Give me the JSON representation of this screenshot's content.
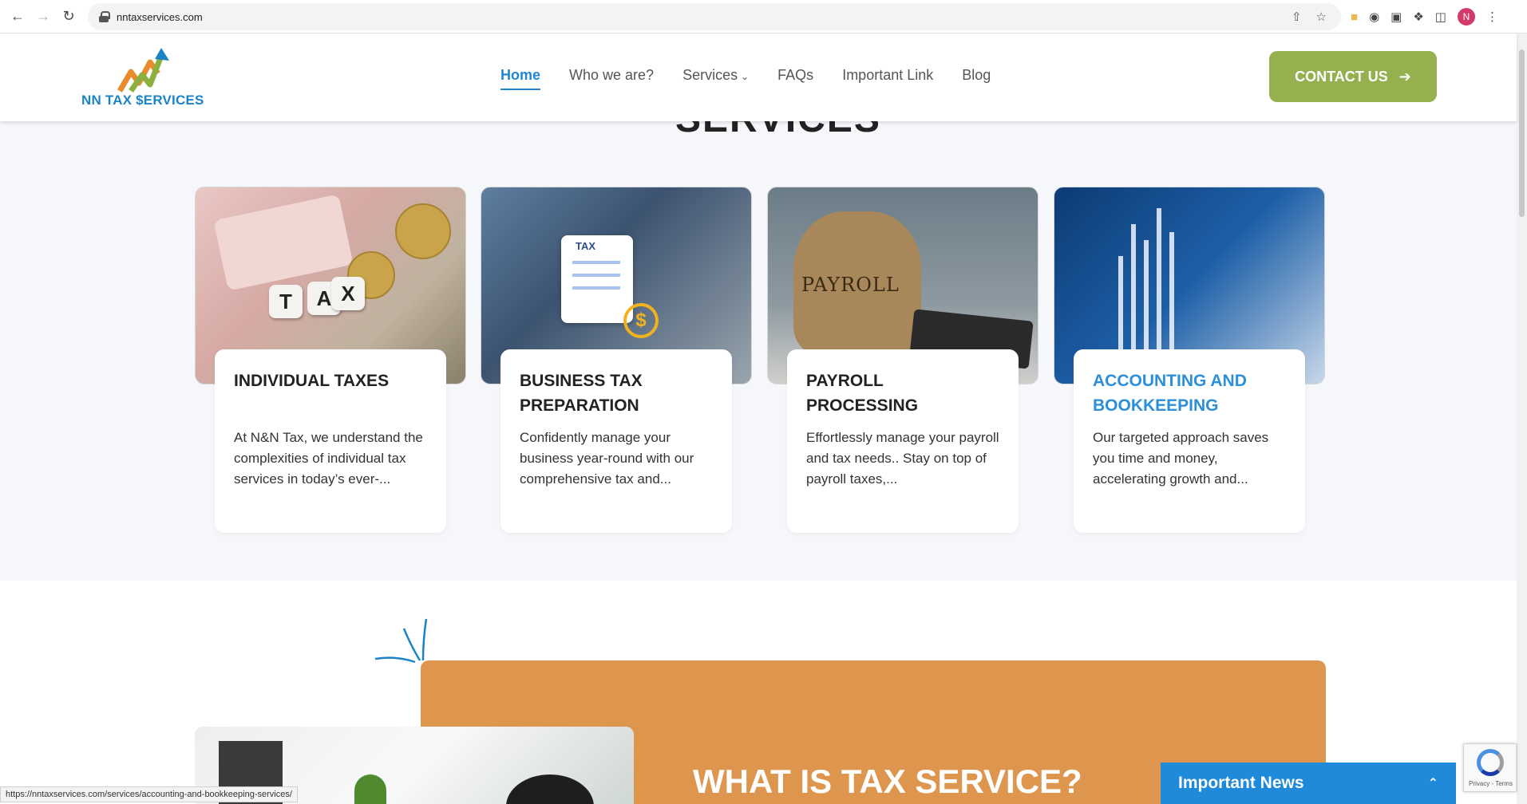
{
  "browser": {
    "url": "nntaxservices.com",
    "status_url": "https://nntaxservices.com/services/accounting-and-bookkeeping-services/",
    "avatar_letter": "N"
  },
  "header": {
    "logo_text": "NN TAX $ERVICES",
    "nav": [
      {
        "label": "Home",
        "active": true
      },
      {
        "label": "Who we are?"
      },
      {
        "label": "Services"
      },
      {
        "label": "FAQs"
      },
      {
        "label": "Important Link"
      },
      {
        "label": "Blog"
      }
    ],
    "contact_label": "CONTACT US"
  },
  "services": {
    "section_title_partial": "SERVICES",
    "cards": [
      {
        "title": "INDIVIDUAL TAXES",
        "description": "At N&N Tax, we understand the complexities of individual tax services in today’s ever-..."
      },
      {
        "title": "BUSINESS TAX PREPARATION",
        "description": "Confidently manage your business year-round with our comprehensive tax and..."
      },
      {
        "title": "PAYROLL PROCESSING",
        "description": "Effortlessly manage your payroll and tax needs.. Stay on top of payroll taxes,..."
      },
      {
        "title": "ACCOUNTING AND BOOKKEEPING",
        "description": "Our targeted approach saves you time and money, accelerating growth and..."
      }
    ],
    "img_tax_dice": [
      "T",
      "A",
      "X"
    ],
    "img2_tag": "TAX",
    "img2_dollar": "$",
    "img3_bag_label": "PAYROLL"
  },
  "lower": {
    "heading": "WHAT IS TAX SERVICE?"
  },
  "news": {
    "label": "Important News"
  },
  "recaptcha": {
    "text": "Privacy - Terms"
  },
  "colors": {
    "brand_blue": "#1f86d2",
    "contact_green": "#94b04f",
    "orange": "#de964e"
  }
}
